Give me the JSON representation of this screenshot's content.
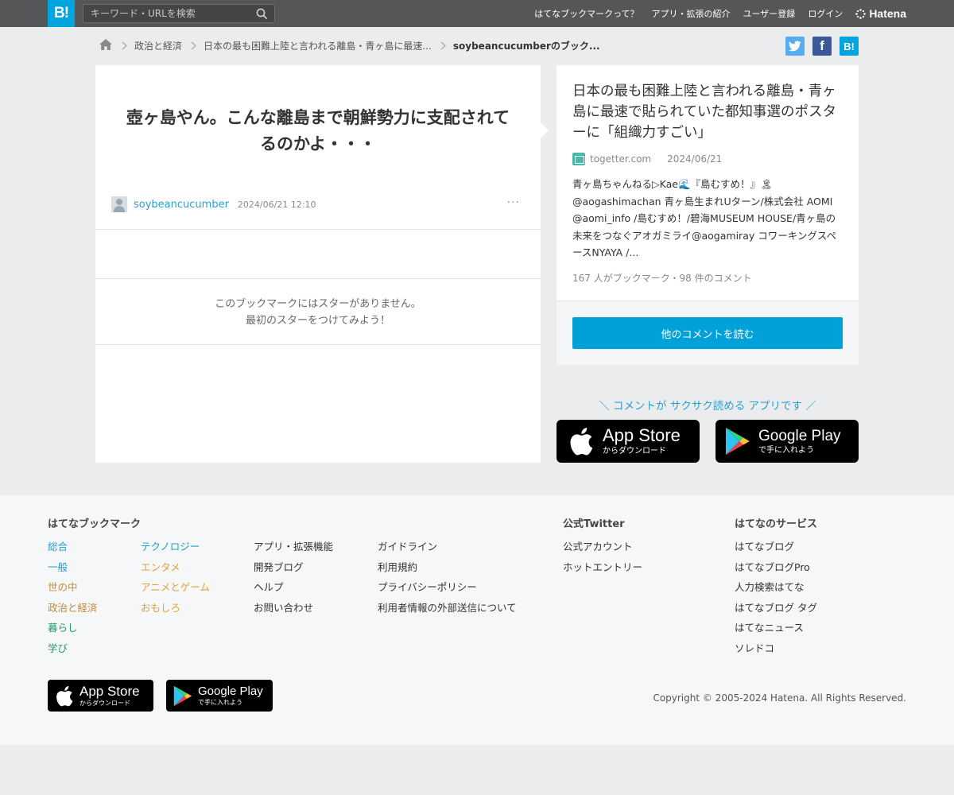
{
  "header": {
    "logo": "B!",
    "search_placeholder": "キーワード・URLを検索",
    "nav": [
      "はてなブックマークって？",
      "アプリ・拡張の紹介",
      "ユーザー登録",
      "ログイン"
    ],
    "hatena_label": "Hatena"
  },
  "breadcrumb": {
    "items": [
      "政治と経済",
      "日本の最も困難上陸と言われる離島・青ヶ島に最速...",
      "soybeancucumberのブック..."
    ]
  },
  "share": {
    "twitter": "t",
    "facebook": "f",
    "hatena": "B!"
  },
  "bookmark": {
    "comment": "壺ヶ島やん。こんな離島まで朝鮮勢力に支配されてるのかよ・・・",
    "user": "soybeancucumber",
    "date": "2024/06/21 12:10",
    "more": "···",
    "star_line1": "このブックマークにはスターがありません。",
    "star_line2": "最初のスターをつけてみよう！"
  },
  "entry": {
    "title": "日本の最も困難上陸と言われる離島・青ヶ島に最速で貼られていた都知事選のポスターに「組織力すごい」",
    "domain": "togetter.com",
    "date": "2024/06/21",
    "description": "青ヶ島ちゃんねる▷Kae🌊『島むすめ！』🏝@aogashimachan 青ヶ島生まれUターン/株式会社 AOMI @aomi_info /島むすめ！/碧海MUSEUM HOUSE/青ヶ島の未来をつなぐアオガミライ@aogamiray コワーキングスペースNYAYA /...",
    "stats": "167 人がブックマーク・98 件のコメント",
    "read_button": "他のコメントを読む"
  },
  "promo": {
    "text": "＼ コメントが サクサク読める アプリです ／",
    "app_store_title": "App Store",
    "app_store_sub": "からダウンロード",
    "google_play_title": "Google Play",
    "google_play_sub": "で手に入れよう"
  },
  "footer": {
    "col1_title": "はてなブックマーク",
    "categories_a": [
      "総合",
      "一般",
      "世の中",
      "政治と経済",
      "暮らし",
      "学び"
    ],
    "categories_b": [
      "テクノロジー",
      "エンタメ",
      "アニメとゲーム",
      "おもしろ"
    ],
    "links_a": [
      "アプリ・拡張機能",
      "開発ブログ",
      "ヘルプ",
      "お問い合わせ"
    ],
    "links_b": [
      "ガイドライン",
      "利用規約",
      "プライバシーポリシー",
      "利用者情報の外部送信について"
    ],
    "twitter_title": "公式Twitter",
    "twitter_links": [
      "公式アカウント",
      "ホットエントリー"
    ],
    "services_title": "はてなのサービス",
    "services": [
      "はてなブログ",
      "はてなブログPro",
      "人力検索はてな",
      "はてなブログ タグ",
      "はてなニュース",
      "ソレドコ"
    ],
    "copyright": "Copyright © 2005-2024 Hatena. All Rights Reserved."
  },
  "colors": {
    "category_colors_a": [
      "#1aa0c9",
      "#1aa0c9",
      "#c48b3a",
      "#c48b3a",
      "#2a9a6a",
      "#2a9a6a"
    ],
    "category_colors_b": [
      "#1aa0c9",
      "#e0a33a",
      "#e0a33a",
      "#e0a33a"
    ],
    "accent": "#00a4de"
  }
}
